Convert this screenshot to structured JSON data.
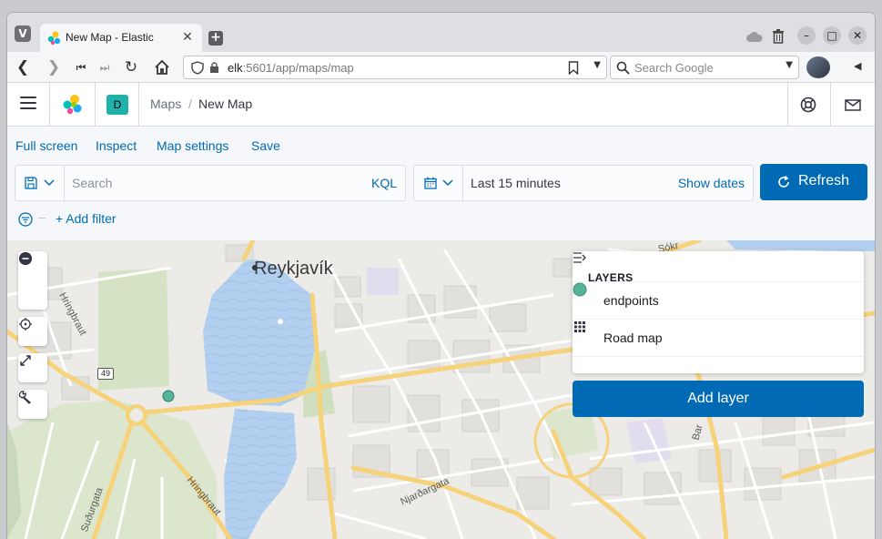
{
  "browser": {
    "tab_title": "New Map - Elastic",
    "url_host": "elk",
    "url_rest": ":5601/app/maps/map",
    "search_placeholder": "Search Google",
    "vivaldi_letter": "V"
  },
  "kibana_header": {
    "space_initial": "D",
    "breadcrumb_app": "Maps",
    "breadcrumb_separator": "/",
    "breadcrumb_current": "New Map"
  },
  "top_menu": {
    "full_screen": "Full screen",
    "inspect": "Inspect",
    "map_settings": "Map settings",
    "save": "Save"
  },
  "query_bar": {
    "search_placeholder": "Search",
    "language": "KQL",
    "time_range": "Last 15 minutes",
    "show_dates": "Show dates",
    "refresh_label": "Refresh",
    "add_filter": "+ Add filter"
  },
  "map": {
    "city_label": "Reykjavík",
    "road_shield": "49",
    "road_labels": {
      "hringbraut_west": "Hringbraut",
      "hringbraut_south": "Hringbraut",
      "sudurgata": "Suðurgata",
      "njardargata": "Njarðargata",
      "top_right_fragment": "Sókr",
      "right_fragment": "Bar"
    }
  },
  "layers_panel": {
    "title": "LAYERS",
    "layers": [
      {
        "name": "endpoints",
        "swatch_color": "#54b399",
        "type": "point"
      },
      {
        "name": "Road map",
        "type": "tiles"
      }
    ],
    "add_layer_label": "Add layer"
  },
  "colors": {
    "primary": "#006bb4",
    "endpoint_point": "#54b399",
    "water": "#b2cfef",
    "park": "#dbe6cc",
    "major_road": "#f8d580"
  },
  "icons": [
    "vivaldi-icon",
    "elastic-favicon",
    "close-icon",
    "plus-icon",
    "cloud-icon",
    "trash-icon",
    "minimize-icon",
    "maximize-icon",
    "close-window-icon",
    "back-icon",
    "forward-icon",
    "rewind-icon",
    "fast-forward-icon",
    "reload-icon",
    "home-icon",
    "shield-icon",
    "lock-icon",
    "bookmark-icon",
    "chevron-down-icon",
    "search-icon",
    "menu-icon",
    "elastic-logo",
    "help-icon",
    "mail-icon",
    "save-query-icon",
    "calendar-icon",
    "refresh-icon",
    "filter-icon",
    "zoom-in-icon",
    "zoom-out-icon",
    "locate-icon",
    "fit-bounds-icon",
    "tools-icon",
    "collapse-icon",
    "grid-icon"
  ]
}
